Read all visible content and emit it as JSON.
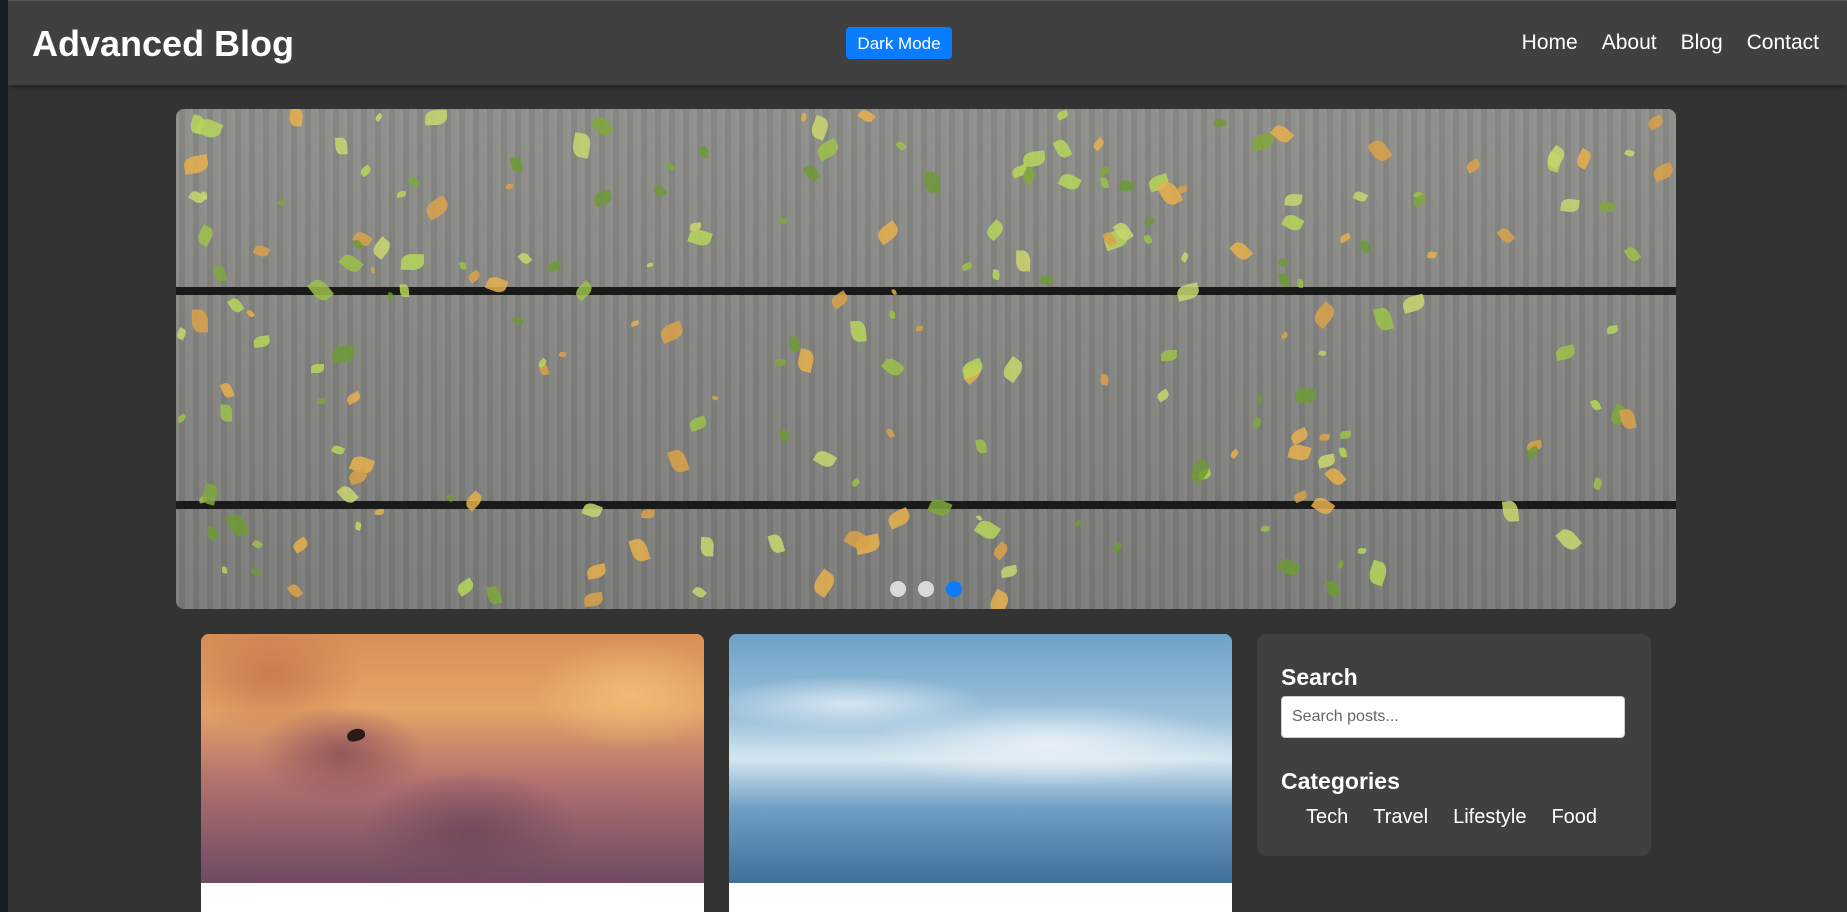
{
  "header": {
    "title": "Advanced Blog",
    "theme_toggle_label": "Dark Mode",
    "nav": [
      "Home",
      "About",
      "Blog",
      "Contact"
    ]
  },
  "hero": {
    "slide_count": 3,
    "active_slide": 3
  },
  "posts": [
    {
      "image": "sunset-sky-with-bird"
    },
    {
      "image": "misty-blue-mountains"
    }
  ],
  "sidebar": {
    "search_title": "Search",
    "search_placeholder": "Search posts...",
    "categories_title": "Categories",
    "categories": [
      "Tech",
      "Travel",
      "Lifestyle",
      "Food"
    ]
  },
  "colors": {
    "accent": "#0a7cff",
    "background": "#333333",
    "header_bg": "#404040",
    "panel_bg": "#404040"
  }
}
